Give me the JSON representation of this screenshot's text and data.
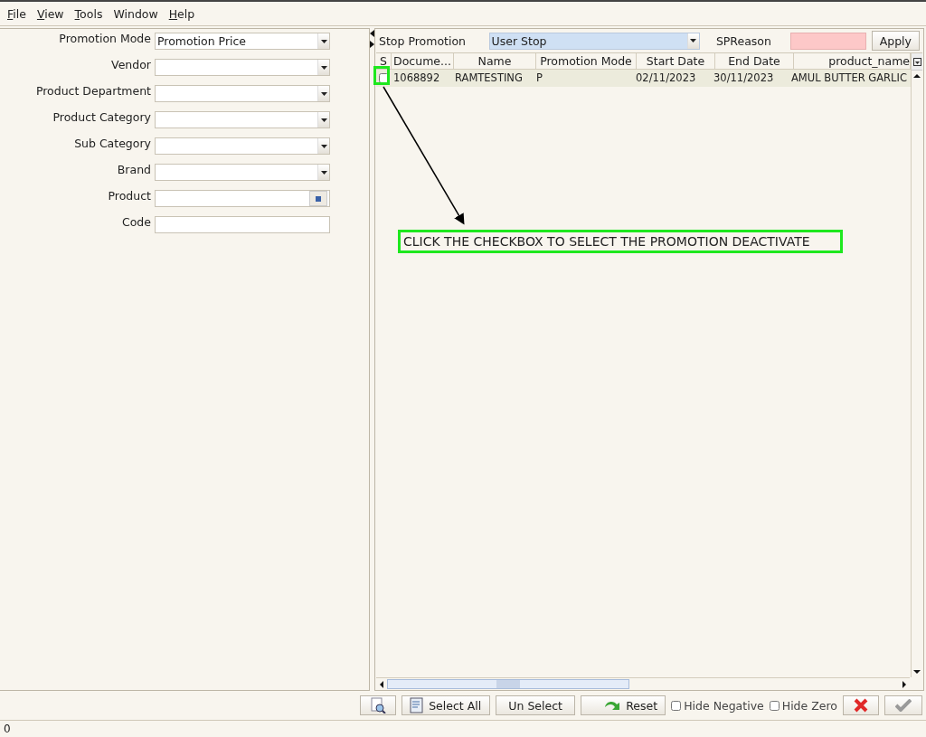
{
  "menu": [
    {
      "label": "File",
      "mnemonic": true
    },
    {
      "label": "View",
      "mnemonic": true
    },
    {
      "label": "Tools",
      "mnemonic": true
    },
    {
      "label": "Window",
      "mnemonic": false
    },
    {
      "label": "Help",
      "mnemonic": true
    }
  ],
  "filters": [
    {
      "label": "Promotion Mode",
      "kind": "combo",
      "value": "Promotion Price"
    },
    {
      "label": "Vendor",
      "kind": "combo"
    },
    {
      "label": "Product Department",
      "kind": "combo"
    },
    {
      "label": "Product Category",
      "kind": "combo"
    },
    {
      "label": "Sub Category",
      "kind": "combo"
    },
    {
      "label": "Brand",
      "kind": "combo"
    },
    {
      "label": "Product",
      "kind": "lookup"
    },
    {
      "label": "Code",
      "kind": "text"
    }
  ],
  "stop_bar": {
    "label": "Stop Promotion",
    "value": "User Stop",
    "reason_label": "SPReason",
    "apply": "Apply"
  },
  "table": {
    "columns": [
      "S",
      "Docume...",
      "Name",
      "Promotion Mode",
      "Start Date",
      "End Date",
      "product_name"
    ],
    "rows": [
      {
        "checked": false,
        "cells": [
          "",
          "1068892",
          "RAMTESTING",
          "P",
          "02/11/2023",
          "30/11/2023",
          "AMUL BUTTER GARLIC"
        ]
      }
    ]
  },
  "callout": "CLICK THE CHECKBOX TO SELECT THE PROMOTION DEACTIVATE",
  "toolbar": {
    "select_all": "Select All",
    "unselect": "Un Select",
    "reset": "Reset",
    "options": [
      {
        "label": "Hide Negative",
        "checked": false
      },
      {
        "label": "Hide Zero",
        "checked": false
      }
    ]
  },
  "status_bar": "0"
}
